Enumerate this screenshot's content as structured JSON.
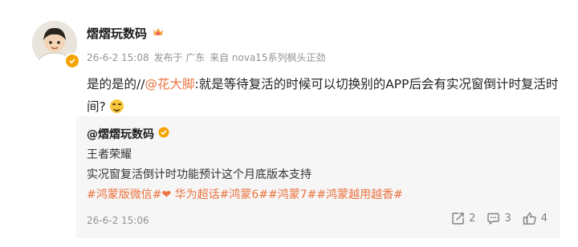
{
  "post": {
    "author": "熠熠玩数码",
    "time": "26-6-2 15:08",
    "published_from": "发布于 广东",
    "device": "来自 nova15系列枫头正劲",
    "text_before": "是的是的//",
    "mention": "@花大脚",
    "text_after": ":就是等待复活的时候可以切换别的APP后会有实况窗倒计时复活时间?"
  },
  "quoted": {
    "author": "@熠熠玩数码",
    "line1": "王者荣耀",
    "line2": "实况窗复活倒计时功能预计这个月底版本支持",
    "tags": "#鸿蒙版微信#❤ 华为超话#鸿蒙6##鸿蒙7##鸿蒙越用越香#",
    "time": "26-6-2 15:06",
    "reposts": "2",
    "comments": "3",
    "likes": "4"
  },
  "colors": {
    "accent_orange": "#eb7340",
    "verified_badge": "#f5a300",
    "meta_gray": "#939393",
    "quote_bg": "#f6f6f6"
  },
  "icons": [
    "avatar",
    "verified-icon",
    "fan-badge-icon",
    "laughing-emoji-icon",
    "repost-icon",
    "comment-icon",
    "like-icon"
  ]
}
